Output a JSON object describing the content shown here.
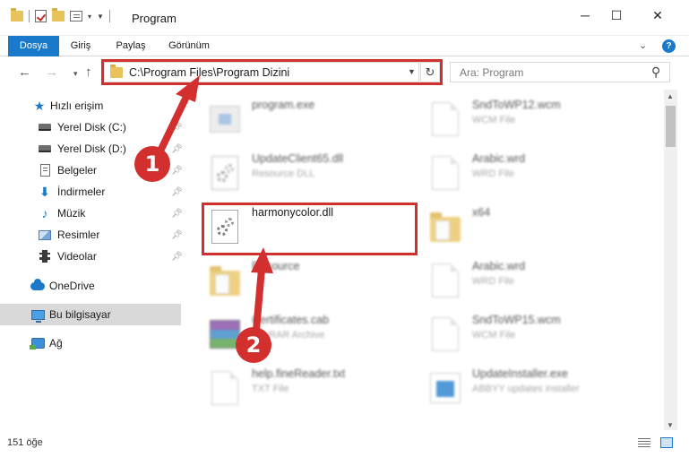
{
  "window": {
    "title": "Program"
  },
  "ribbon": {
    "tabs": [
      {
        "label": "Dosya",
        "active": true
      },
      {
        "label": "Giriş"
      },
      {
        "label": "Paylaş"
      },
      {
        "label": "Görünüm"
      }
    ],
    "help": "?"
  },
  "address": {
    "path": "C:\\Program Files\\Program Dizini"
  },
  "search": {
    "placeholder": "Ara: Program"
  },
  "sidebar": {
    "quick_access": "Hızlı erişim",
    "items": [
      {
        "label": "Yerel Disk (C:)",
        "icon": "drive-icon"
      },
      {
        "label": "Yerel Disk (D:)",
        "icon": "drive-icon"
      },
      {
        "label": "Belgeler",
        "icon": "documents-icon"
      },
      {
        "label": "İndirmeler",
        "icon": "downloads-icon"
      },
      {
        "label": "Müzik",
        "icon": "music-icon"
      },
      {
        "label": "Resimler",
        "icon": "pictures-icon"
      },
      {
        "label": "Videolar",
        "icon": "videos-icon"
      }
    ],
    "onedrive": "OneDrive",
    "this_pc": "Bu bilgisayar",
    "network": "Ağ"
  },
  "files": {
    "left": [
      {
        "name": "program.exe",
        "type": "",
        "icon": "exe-icon"
      },
      {
        "name": "UpdateClient65.dll",
        "type": "Resource DLL",
        "icon": "dll-icon"
      },
      {
        "name": "harmonycolor.dll",
        "type": "",
        "icon": "dll-icon"
      },
      {
        "name": "Resource",
        "type": "",
        "icon": "folder-icon"
      },
      {
        "name": "Certificates.cab",
        "type": "WinRAR Archive",
        "icon": "archive-icon"
      },
      {
        "name": "help.fineReader.txt",
        "type": "TXT File",
        "icon": "document-icon"
      }
    ],
    "right": [
      {
        "name": "SndToWP12.wcm",
        "type": "WCM File",
        "icon": "document-icon"
      },
      {
        "name": "Arabic.wrd",
        "type": "WRD File",
        "icon": "document-icon"
      },
      {
        "name": "x64",
        "type": "",
        "icon": "folder-icon"
      },
      {
        "name": "Arabic.wrd",
        "type": "WRD File",
        "icon": "document-icon"
      },
      {
        "name": "SndToWP15.wcm",
        "type": "WCM File",
        "icon": "document-icon"
      },
      {
        "name": "UpdateInstaller.exe",
        "type": "ABBYY updates installer",
        "icon": "installer-icon"
      }
    ]
  },
  "status": {
    "item_count": "151 öğe"
  },
  "annotations": {
    "step1": "1",
    "step2": "2",
    "color": "#d32f2f"
  }
}
